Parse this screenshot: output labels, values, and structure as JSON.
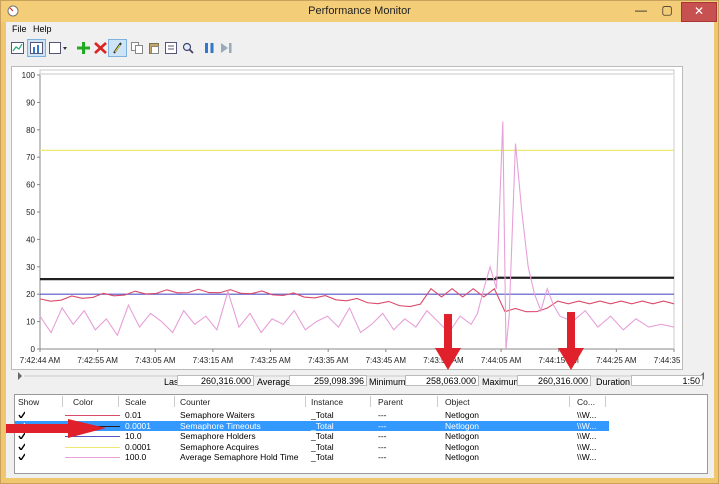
{
  "window": {
    "title": "Performance Monitor",
    "minimize_glyph": "—",
    "maximize_glyph": "▢",
    "close_glyph": "✕"
  },
  "menu": {
    "file": "File",
    "help": "Help"
  },
  "toolbar_icons": [
    "view-graph-icon",
    "view-histogram-icon",
    "change-graph-type-icon",
    "add-counter-icon",
    "delete-counter-icon",
    "highlight-icon",
    "copy-properties-icon",
    "paste-counter-list-icon",
    "properties-icon",
    "zoom-icon",
    "freeze-display-icon",
    "update-data-icon"
  ],
  "graph": {
    "yticks": [
      "100",
      "90",
      "80",
      "70",
      "60",
      "50",
      "40",
      "30",
      "20",
      "10",
      "0"
    ],
    "xticks": [
      "7:42:44 AM",
      "7:42:55 AM",
      "7:43:05 AM",
      "7:43:15 AM",
      "7:43:25 AM",
      "7:43:35 AM",
      "7:43:45 AM",
      "7:43:55 AM",
      "7:44:05 AM",
      "7:44:15 AM",
      "7:44:25 AM",
      "7:44:35 AM"
    ]
  },
  "stats": {
    "last_label": "Last",
    "last_value": "260,316.000",
    "average_label": "Average",
    "average_value": "259,098.396",
    "minimum_label": "Minimum",
    "minimum_value": "258,063.000",
    "maximum_label": "Maximum",
    "maximum_value": "260,316.000",
    "duration_label": "Duration",
    "duration_value": "1:50"
  },
  "legend": {
    "headers": {
      "show": "Show",
      "color": "Color",
      "scale": "Scale",
      "counter": "Counter",
      "instance": "Instance",
      "parent": "Parent",
      "object": "Object",
      "computer": "Co..."
    },
    "rows": [
      {
        "show": true,
        "color": "#d94b6b",
        "scale": "0.01",
        "counter": "Semaphore Waiters",
        "instance": "_Total",
        "parent": "---",
        "object": "Netlogon",
        "computer": "\\\\W...",
        "selected": false
      },
      {
        "show": true,
        "color": "#202020",
        "scale": "0.0001",
        "counter": "Semaphore Timeouts",
        "instance": "_Total",
        "parent": "---",
        "object": "Netlogon",
        "computer": "\\\\W...",
        "selected": true
      },
      {
        "show": true,
        "color": "#5555c8",
        "scale": "10.0",
        "counter": "Semaphore Holders",
        "instance": "_Total",
        "parent": "---",
        "object": "Netlogon",
        "computer": "\\\\W...",
        "selected": false
      },
      {
        "show": true,
        "color": "#f0e870",
        "scale": "0.0001",
        "counter": "Semaphore Acquires",
        "instance": "_Total",
        "parent": "---",
        "object": "Netlogon",
        "computer": "\\\\W...",
        "selected": false
      },
      {
        "show": true,
        "color": "#e7a0d8",
        "scale": "100.0",
        "counter": "Average Semaphore Hold Time",
        "instance": "_Total",
        "parent": "---",
        "object": "Netlogon",
        "computer": "\\\\W...",
        "selected": false
      }
    ]
  },
  "colors": {
    "arrow": "#e0202a",
    "selection": "#3399ff",
    "title_bar": "#f3cd78"
  }
}
